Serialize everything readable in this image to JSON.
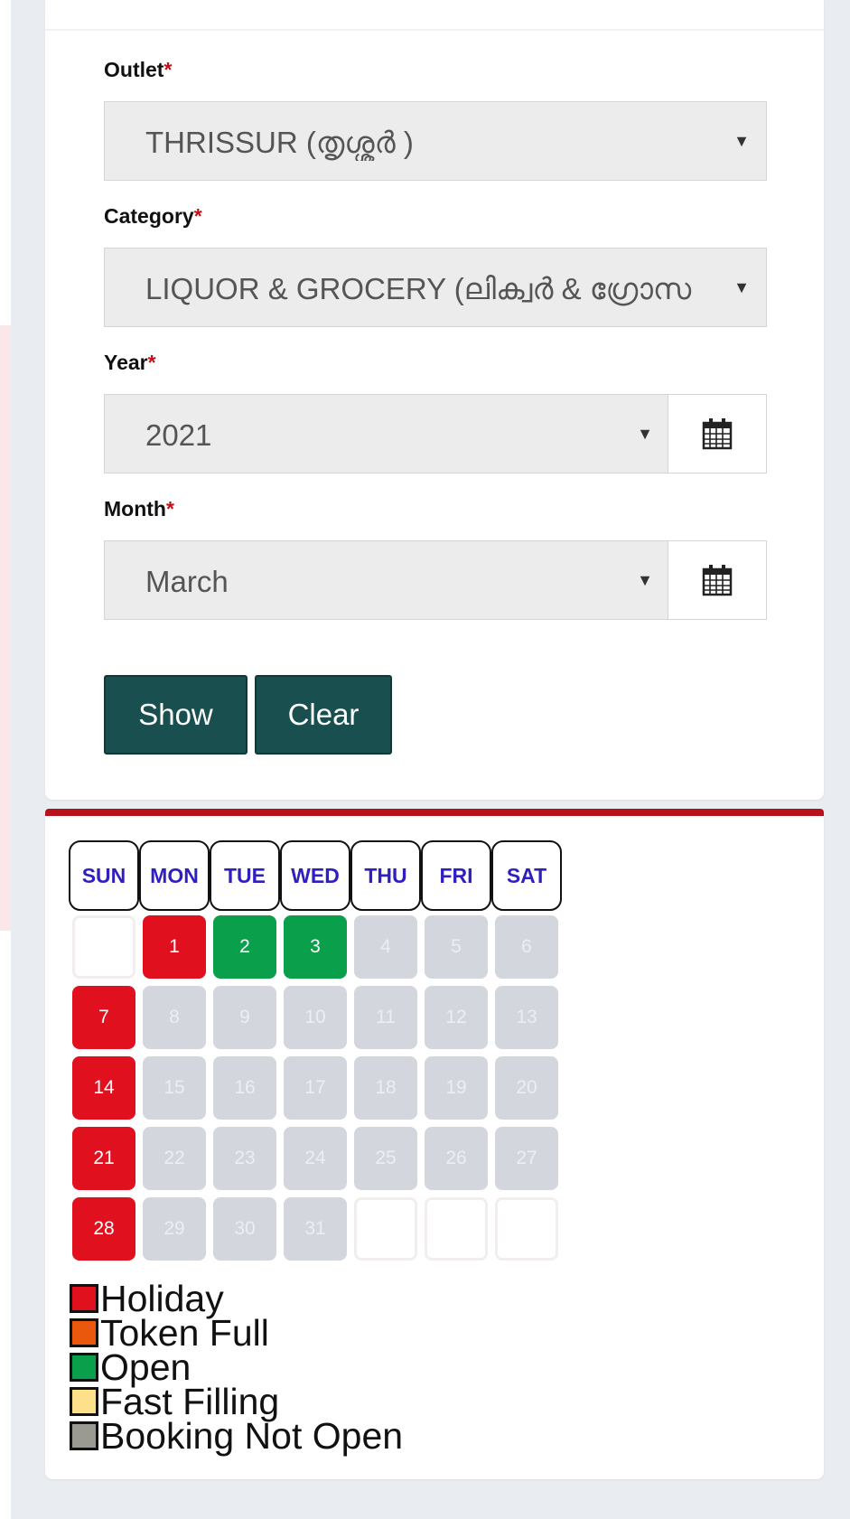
{
  "form": {
    "outlet": {
      "label": "Outlet",
      "required_mark": "*",
      "value": "THRISSUR (തൃശ്ശൂർ )"
    },
    "category": {
      "label": "Category",
      "required_mark": "*",
      "value": "LIQUOR & GROCERY (ലിക്വർ & ഗ്രോസ"
    },
    "year": {
      "label": "Year",
      "required_mark": "*",
      "value": "2021"
    },
    "month": {
      "label": "Month",
      "required_mark": "*",
      "value": "March"
    },
    "caret": "▼",
    "show_label": "Show",
    "clear_label": "Clear"
  },
  "calendar": {
    "weekdays": [
      "SUN",
      "MON",
      "TUE",
      "WED",
      "THU",
      "FRI",
      "SAT"
    ],
    "start_offset": 1,
    "days": [
      {
        "n": "1",
        "s": "holiday"
      },
      {
        "n": "2",
        "s": "open"
      },
      {
        "n": "3",
        "s": "open"
      },
      {
        "n": "4",
        "s": "notopen"
      },
      {
        "n": "5",
        "s": "notopen"
      },
      {
        "n": "6",
        "s": "notopen"
      },
      {
        "n": "7",
        "s": "holiday"
      },
      {
        "n": "8",
        "s": "notopen"
      },
      {
        "n": "9",
        "s": "notopen"
      },
      {
        "n": "10",
        "s": "notopen"
      },
      {
        "n": "11",
        "s": "notopen"
      },
      {
        "n": "12",
        "s": "notopen"
      },
      {
        "n": "13",
        "s": "notopen"
      },
      {
        "n": "14",
        "s": "holiday"
      },
      {
        "n": "15",
        "s": "notopen"
      },
      {
        "n": "16",
        "s": "notopen"
      },
      {
        "n": "17",
        "s": "notopen"
      },
      {
        "n": "18",
        "s": "notopen"
      },
      {
        "n": "19",
        "s": "notopen"
      },
      {
        "n": "20",
        "s": "notopen"
      },
      {
        "n": "21",
        "s": "holiday"
      },
      {
        "n": "22",
        "s": "notopen"
      },
      {
        "n": "23",
        "s": "notopen"
      },
      {
        "n": "24",
        "s": "notopen"
      },
      {
        "n": "25",
        "s": "notopen"
      },
      {
        "n": "26",
        "s": "notopen"
      },
      {
        "n": "27",
        "s": "notopen"
      },
      {
        "n": "28",
        "s": "holiday"
      },
      {
        "n": "29",
        "s": "notopen"
      },
      {
        "n": "30",
        "s": "notopen"
      },
      {
        "n": "31",
        "s": "notopen"
      }
    ],
    "trailing_empty": 3
  },
  "legend": [
    {
      "label": "Holiday",
      "color": "#e0101e"
    },
    {
      "label": "Token Full",
      "color": "#e9580c"
    },
    {
      "label": "Open",
      "color": "#0aa04b"
    },
    {
      "label": "Fast Filling",
      "color": "#fde089"
    },
    {
      "label": "Booking Not Open",
      "color": "#9a9a92"
    }
  ],
  "colors": {
    "button_bg": "#1a4f4f",
    "required_star": "#c0111b",
    "weekday_text": "#2f1fbf",
    "divider": "#b5121b"
  }
}
